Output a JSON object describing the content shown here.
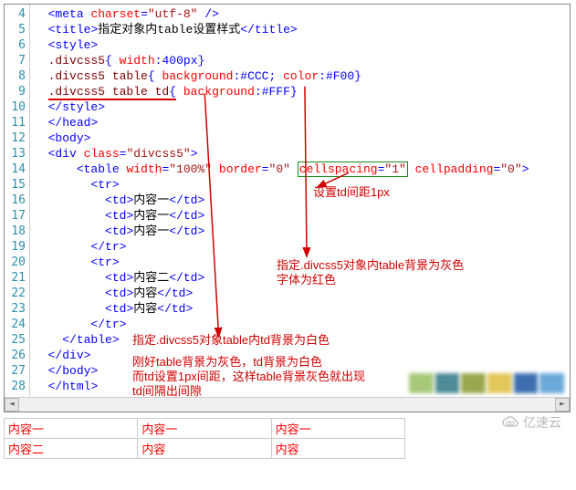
{
  "gutter": {
    "start": 4,
    "end": 28
  },
  "code_lines": [
    {
      "indent": 1,
      "tokens": [
        [
          "p",
          "<"
        ],
        [
          "t",
          "meta"
        ],
        [
          "tx",
          " "
        ],
        [
          "a",
          "charset"
        ],
        [
          "p",
          "="
        ],
        [
          "s",
          "\"utf-8\""
        ],
        [
          "tx",
          " "
        ],
        [
          "p",
          "/>"
        ]
      ]
    },
    {
      "indent": 1,
      "tokens": [
        [
          "p",
          "<"
        ],
        [
          "t",
          "title"
        ],
        [
          "p",
          ">"
        ],
        [
          "tx",
          "指定对象内table设置样式"
        ],
        [
          "p",
          "</"
        ],
        [
          "t",
          "title"
        ],
        [
          "p",
          ">"
        ]
      ]
    },
    {
      "indent": 1,
      "tokens": [
        [
          "p",
          "<"
        ],
        [
          "t",
          "style"
        ],
        [
          "p",
          ">"
        ]
      ]
    },
    {
      "indent": 1,
      "tokens": [
        [
          "sel",
          ".divcss5"
        ],
        [
          "p",
          "{"
        ],
        [
          "tx",
          " "
        ],
        [
          "a",
          "width"
        ],
        [
          "p",
          ":"
        ],
        [
          "val",
          "400px"
        ],
        [
          "p",
          "}"
        ]
      ]
    },
    {
      "indent": 1,
      "tokens": [
        [
          "sel",
          ".divcss5 table"
        ],
        [
          "p",
          "{"
        ],
        [
          "tx",
          " "
        ],
        [
          "a",
          "background"
        ],
        [
          "p",
          ":"
        ],
        [
          "val",
          "#CCC"
        ],
        [
          "p",
          ";"
        ],
        [
          "tx",
          " "
        ],
        [
          "a",
          "color"
        ],
        [
          "p",
          ":"
        ],
        [
          "val",
          "#F00"
        ],
        [
          "p",
          "}"
        ]
      ]
    },
    {
      "indent": 1,
      "line9": true,
      "tokens": [
        [
          "sel_u",
          ".divcss5 table td"
        ],
        [
          "p_u",
          "{"
        ],
        [
          "tx",
          " "
        ],
        [
          "a",
          "background"
        ],
        [
          "p",
          ":"
        ],
        [
          "val",
          "#FFF"
        ],
        [
          "p",
          "}"
        ]
      ]
    },
    {
      "indent": 1,
      "tokens": [
        [
          "p",
          "</"
        ],
        [
          "t",
          "style"
        ],
        [
          "p",
          ">"
        ]
      ]
    },
    {
      "indent": 1,
      "tokens": [
        [
          "p",
          "</"
        ],
        [
          "t",
          "head"
        ],
        [
          "p",
          ">"
        ]
      ]
    },
    {
      "indent": 1,
      "tokens": [
        [
          "p",
          "<"
        ],
        [
          "t",
          "body"
        ],
        [
          "p",
          ">"
        ]
      ]
    },
    {
      "indent": 1,
      "tokens": [
        [
          "p",
          "<"
        ],
        [
          "t",
          "div"
        ],
        [
          "tx",
          " "
        ],
        [
          "a",
          "class"
        ],
        [
          "p",
          "="
        ],
        [
          "s",
          "\"divcss5\""
        ],
        [
          "p",
          ">"
        ]
      ]
    },
    {
      "indent": 3,
      "table_line": true,
      "tokens": [
        [
          "p",
          "<"
        ],
        [
          "t",
          "table"
        ],
        [
          "tx",
          " "
        ],
        [
          "a",
          "width"
        ],
        [
          "p",
          "="
        ],
        [
          "s",
          "\"100%\""
        ],
        [
          "tx",
          " "
        ],
        [
          "a",
          "border"
        ],
        [
          "p",
          "="
        ],
        [
          "s",
          "\"0\""
        ],
        [
          "tx",
          " "
        ],
        [
          "boxed",
          "cellspacing=\"1\""
        ],
        [
          "tx",
          " "
        ],
        [
          "a",
          "cellpadding"
        ],
        [
          "p",
          "="
        ],
        [
          "s",
          "\"0\""
        ],
        [
          "p",
          ">"
        ]
      ]
    },
    {
      "indent": 4,
      "tokens": [
        [
          "p",
          "<"
        ],
        [
          "t",
          "tr"
        ],
        [
          "p",
          ">"
        ]
      ]
    },
    {
      "indent": 5,
      "tokens": [
        [
          "p",
          "<"
        ],
        [
          "t",
          "td"
        ],
        [
          "p",
          ">"
        ],
        [
          "tx",
          "内容一"
        ],
        [
          "p",
          "</"
        ],
        [
          "t",
          "td"
        ],
        [
          "p",
          ">"
        ]
      ]
    },
    {
      "indent": 5,
      "tokens": [
        [
          "p",
          "<"
        ],
        [
          "t",
          "td"
        ],
        [
          "p",
          ">"
        ],
        [
          "tx",
          "内容一"
        ],
        [
          "p",
          "</"
        ],
        [
          "t",
          "td"
        ],
        [
          "p",
          ">"
        ]
      ]
    },
    {
      "indent": 5,
      "tokens": [
        [
          "p",
          "<"
        ],
        [
          "t",
          "td"
        ],
        [
          "p",
          ">"
        ],
        [
          "tx",
          "内容一"
        ],
        [
          "p",
          "</"
        ],
        [
          "t",
          "td"
        ],
        [
          "p",
          ">"
        ]
      ]
    },
    {
      "indent": 4,
      "tokens": [
        [
          "p",
          "</"
        ],
        [
          "t",
          "tr"
        ],
        [
          "p",
          ">"
        ]
      ]
    },
    {
      "indent": 4,
      "tokens": [
        [
          "p",
          "<"
        ],
        [
          "t",
          "tr"
        ],
        [
          "p",
          ">"
        ]
      ]
    },
    {
      "indent": 5,
      "tokens": [
        [
          "p",
          "<"
        ],
        [
          "t",
          "td"
        ],
        [
          "p",
          ">"
        ],
        [
          "tx",
          "内容二"
        ],
        [
          "p",
          "</"
        ],
        [
          "t",
          "td"
        ],
        [
          "p",
          ">"
        ]
      ]
    },
    {
      "indent": 5,
      "tokens": [
        [
          "p",
          "<"
        ],
        [
          "t",
          "td"
        ],
        [
          "p",
          ">"
        ],
        [
          "tx",
          "内容"
        ],
        [
          "p",
          "</"
        ],
        [
          "t",
          "td"
        ],
        [
          "p",
          ">"
        ]
      ]
    },
    {
      "indent": 5,
      "tokens": [
        [
          "p",
          "<"
        ],
        [
          "t",
          "td"
        ],
        [
          "p",
          ">"
        ],
        [
          "tx",
          "内容"
        ],
        [
          "p",
          "</"
        ],
        [
          "t",
          "td"
        ],
        [
          "p",
          ">"
        ]
      ]
    },
    {
      "indent": 4,
      "tokens": [
        [
          "p",
          "</"
        ],
        [
          "t",
          "tr"
        ],
        [
          "p",
          ">"
        ]
      ]
    },
    {
      "indent": 2,
      "tokens": [
        [
          "p",
          "</"
        ],
        [
          "t",
          "table"
        ],
        [
          "p",
          ">"
        ]
      ]
    },
    {
      "indent": 1,
      "tokens": [
        [
          "p",
          "</"
        ],
        [
          "t",
          "div"
        ],
        [
          "p",
          ">"
        ]
      ]
    },
    {
      "indent": 1,
      "tokens": [
        [
          "p",
          "</"
        ],
        [
          "t",
          "body"
        ],
        [
          "p",
          ">"
        ]
      ]
    },
    {
      "indent": 1,
      "tokens": [
        [
          "p",
          "</"
        ],
        [
          "t",
          "html"
        ],
        [
          "p",
          ">"
        ]
      ]
    }
  ],
  "annotations": {
    "cellspacing_note": "设置td间距1px",
    "table_bg_note_l1": "指定.divcss5对象内table背景为灰色",
    "table_bg_note_l2": "字体为红色",
    "td_bg_note": "指定.divcss5对象table内td背景为白色",
    "summary_l1": "刚好table背景为灰色，td背景为白色",
    "summary_l2": "而td设置1px间距，这样table背景灰色就出现",
    "summary_l3": "td间隔出间隙"
  },
  "preview": {
    "rows": [
      [
        "内容一",
        "内容一",
        "内容一"
      ],
      [
        "内容二",
        "内容",
        "内容"
      ]
    ]
  },
  "watermark": "亿速云",
  "blur_colors": [
    "#9ec36a",
    "#3b7f8b",
    "#8e9f3a",
    "#e0c14a",
    "#2a5fa8",
    "#5aa0d6"
  ]
}
